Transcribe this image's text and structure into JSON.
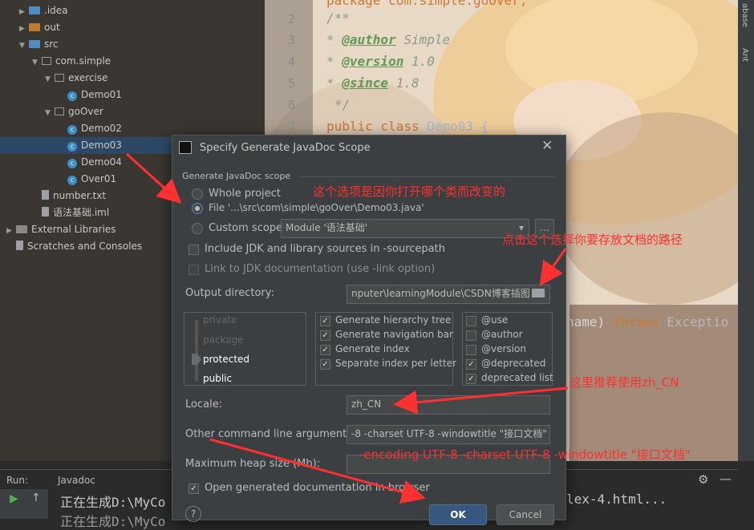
{
  "tree": {
    "items": [
      {
        "label": ".idea",
        "type": "folder-blue",
        "indent": 1,
        "arrow": "right"
      },
      {
        "label": "out",
        "type": "folder-orange",
        "indent": 1,
        "arrow": "right"
      },
      {
        "label": "src",
        "type": "folder-blue",
        "indent": 1,
        "arrow": "down"
      },
      {
        "label": "com.simple",
        "type": "package",
        "indent": 2,
        "arrow": "down"
      },
      {
        "label": "exercise",
        "type": "package",
        "indent": 3,
        "arrow": "down"
      },
      {
        "label": "Demo01",
        "type": "class",
        "indent": 4,
        "arrow": ""
      },
      {
        "label": "goOver",
        "type": "package",
        "indent": 3,
        "arrow": "down"
      },
      {
        "label": "Demo02",
        "type": "class",
        "indent": 4,
        "arrow": ""
      },
      {
        "label": "Demo03",
        "type": "class",
        "indent": 4,
        "arrow": "",
        "selected": true
      },
      {
        "label": "Demo04",
        "type": "class",
        "indent": 4,
        "arrow": ""
      },
      {
        "label": "Over01",
        "type": "class",
        "indent": 4,
        "arrow": ""
      },
      {
        "label": "number.txt",
        "type": "file",
        "indent": 2,
        "arrow": ""
      },
      {
        "label": "语法基础.iml",
        "type": "file",
        "indent": 2,
        "arrow": ""
      },
      {
        "label": "External Libraries",
        "type": "lib",
        "indent": 0,
        "arrow": "right"
      },
      {
        "label": "Scratches and Consoles",
        "type": "scratch",
        "indent": 0,
        "arrow": ""
      }
    ]
  },
  "editor": {
    "line_numbers": [
      "2",
      "3",
      "4",
      "5",
      "6",
      "7"
    ],
    "lines": {
      "l1": "package com.simple.goOver;",
      "l2_open": "/**",
      "author_tag": "@author",
      "author_val": " Simple",
      "version_tag": "@version",
      "version_val": " 1.0",
      "since_tag": "@since",
      "since_val": " 1.8",
      "close": "*/",
      "class_kw": "public class",
      "class_name": " Demo03 {",
      "frag_name": "name)",
      "frag_throws": " throws",
      "frag_exc": " Exceptio"
    }
  },
  "right_bar": {
    "label1": "abase",
    "label2": "Ant"
  },
  "run_panel": {
    "run_label": "Run:",
    "tab_label": "Javadoc",
    "console_line1": "正在生成D:\\MyCo",
    "console_line1_tail": "lex-4.html...",
    "console_line2": "正在生成D:\\MyCo"
  },
  "dialog": {
    "title": "Specify Generate JavaDoc Scope",
    "scope_group": "Generate JavaDoc scope",
    "whole_project": "Whole project",
    "file_option": "File '...\\src\\com\\simple\\goOver\\Demo03.java'",
    "custom_scope": "Custom scope",
    "module_value": "Module '语法基础'",
    "include_jdk": "Include JDK and library sources in -sourcepath",
    "link_jdk": "Link to JDK documentation (use -link option)",
    "output_dir_label": "Output directory:",
    "output_dir_value": "nputer\\learningModule\\CSDN博客插图",
    "visibility_levels": [
      "private",
      "package",
      "protected",
      "public"
    ],
    "options": [
      {
        "label": "Generate hierarchy tree",
        "checked": true
      },
      {
        "label": "Generate navigation bar",
        "checked": true
      },
      {
        "label": "Generate index",
        "checked": true
      },
      {
        "label": "Separate index per letter",
        "checked": true
      }
    ],
    "tags": [
      {
        "label": "@use",
        "checked": false
      },
      {
        "label": "@author",
        "checked": false
      },
      {
        "label": "@version",
        "checked": false
      },
      {
        "label": "@deprecated",
        "checked": true
      },
      {
        "label": "deprecated list",
        "checked": true
      }
    ],
    "locale_label": "Locale:",
    "locale_value": "zh_CN",
    "other_args_label": "Other command line arguments:",
    "other_args_value": "-8 -charset UTF-8 -windowtitle \"接口文档\"",
    "max_heap_label": "Maximum heap size (Mb):",
    "open_generated": "Open generated documentation in browser",
    "ok": "OK",
    "cancel": "Cancel",
    "help": "?"
  },
  "annotations": {
    "a1": "这个选项是因你打开哪个类而改变的",
    "a2": "点击这个选择你要存放文档的路径",
    "a3": "这里推荐使用zh_CN",
    "a4": "-encoding UTF-8 -charset UTF-8 -windowtitle \"接口文档\""
  },
  "colors": {
    "annotation": "#ff3030",
    "ok_button": "#365880",
    "selection": "#2d4866"
  }
}
